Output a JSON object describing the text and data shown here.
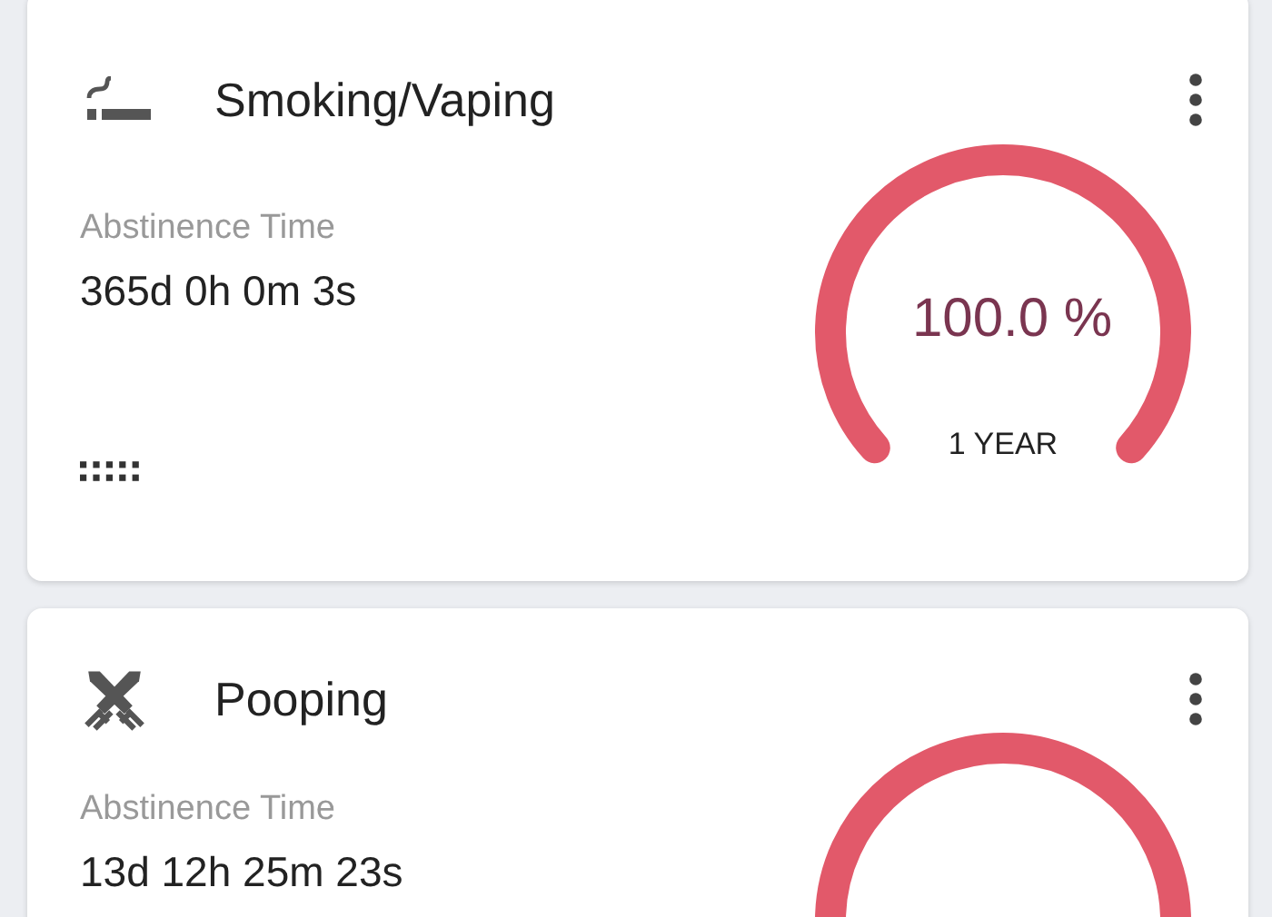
{
  "trackers": [
    {
      "kind": "smoking",
      "title": "Smoking/Vaping",
      "label": "Abstinence Time",
      "value": "365d 0h 0m 3s",
      "gauge": {
        "percent": "100.0 %",
        "caption": "1 YEAR"
      }
    },
    {
      "kind": "pooping",
      "title": "Pooping",
      "label": "Abstinence Time",
      "value": "13d 12h 25m 23s"
    }
  ]
}
